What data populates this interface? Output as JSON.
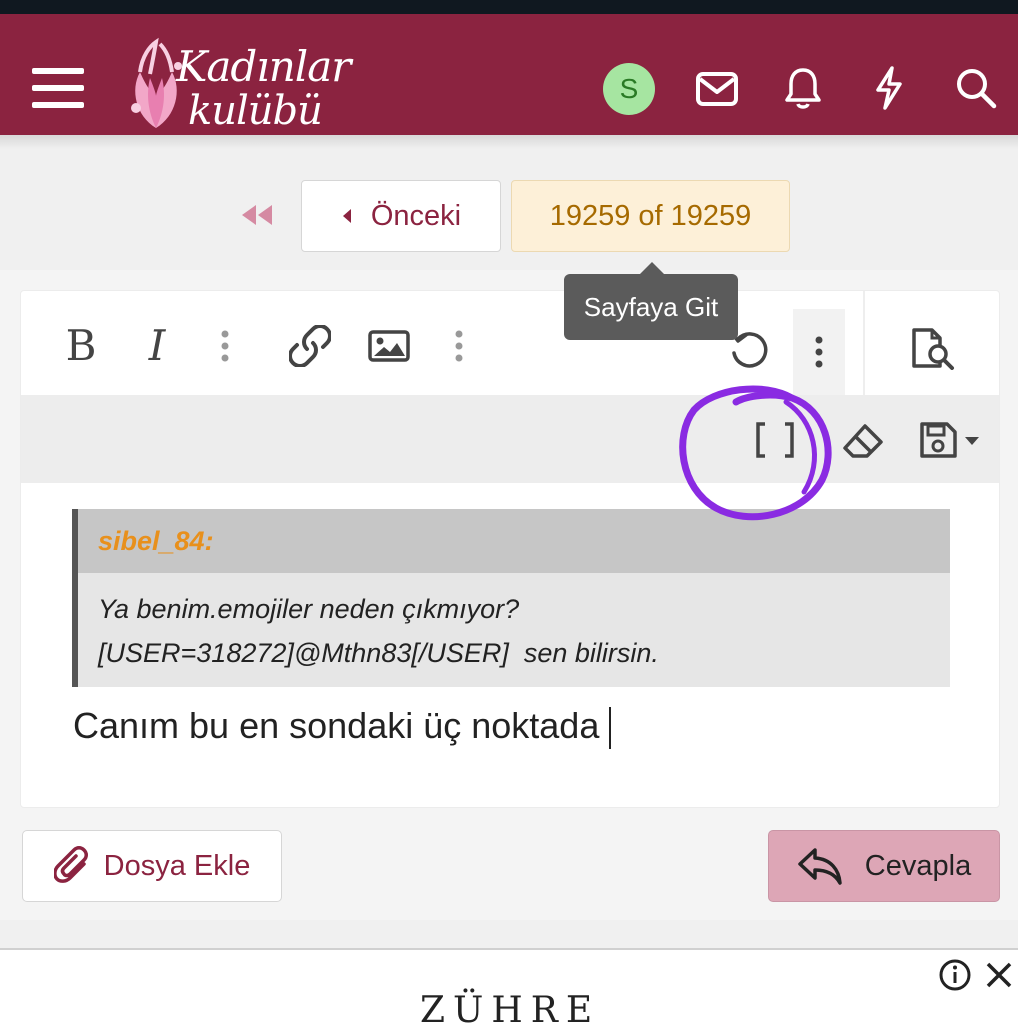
{
  "header": {
    "logo_line1": "Kadınlar",
    "logo_line2": "kulübü",
    "avatar_initial": "S",
    "icons": [
      "menu-icon",
      "mail-icon",
      "bell-icon",
      "bolt-icon",
      "search-icon"
    ],
    "bg_color": "#8b2340"
  },
  "pagination": {
    "prev_label": "Önceki",
    "page_status": "19259 of 19259",
    "tooltip": "Sayfaya Git"
  },
  "editor": {
    "toolbar": {
      "bold": "B",
      "italic": "I",
      "icons": [
        "more-vertical-icon",
        "link-icon",
        "image-icon",
        "undo-icon",
        "preview-icon",
        "fullscreen-icon",
        "eraser-icon",
        "save-draft-icon"
      ]
    },
    "quote": {
      "author": "sibel_84:",
      "line1": "Ya benim.emojiler neden çıkmıyor?",
      "line2": "[USER=318272]@Mthn83[/USER]  sen bilirsin."
    },
    "reply_text": "Canım bu en sondaki üç noktada"
  },
  "actions": {
    "attach_label": "Dosya Ekle",
    "reply_label": "Cevapla"
  },
  "ad": {
    "brand": "ZÜHRE"
  },
  "colors": {
    "accent": "#8b2340",
    "page_badge": "#fdf0d8",
    "reply_button": "#dda6b6",
    "quote_author": "#e8901c",
    "annotation": "#8a2be2"
  }
}
